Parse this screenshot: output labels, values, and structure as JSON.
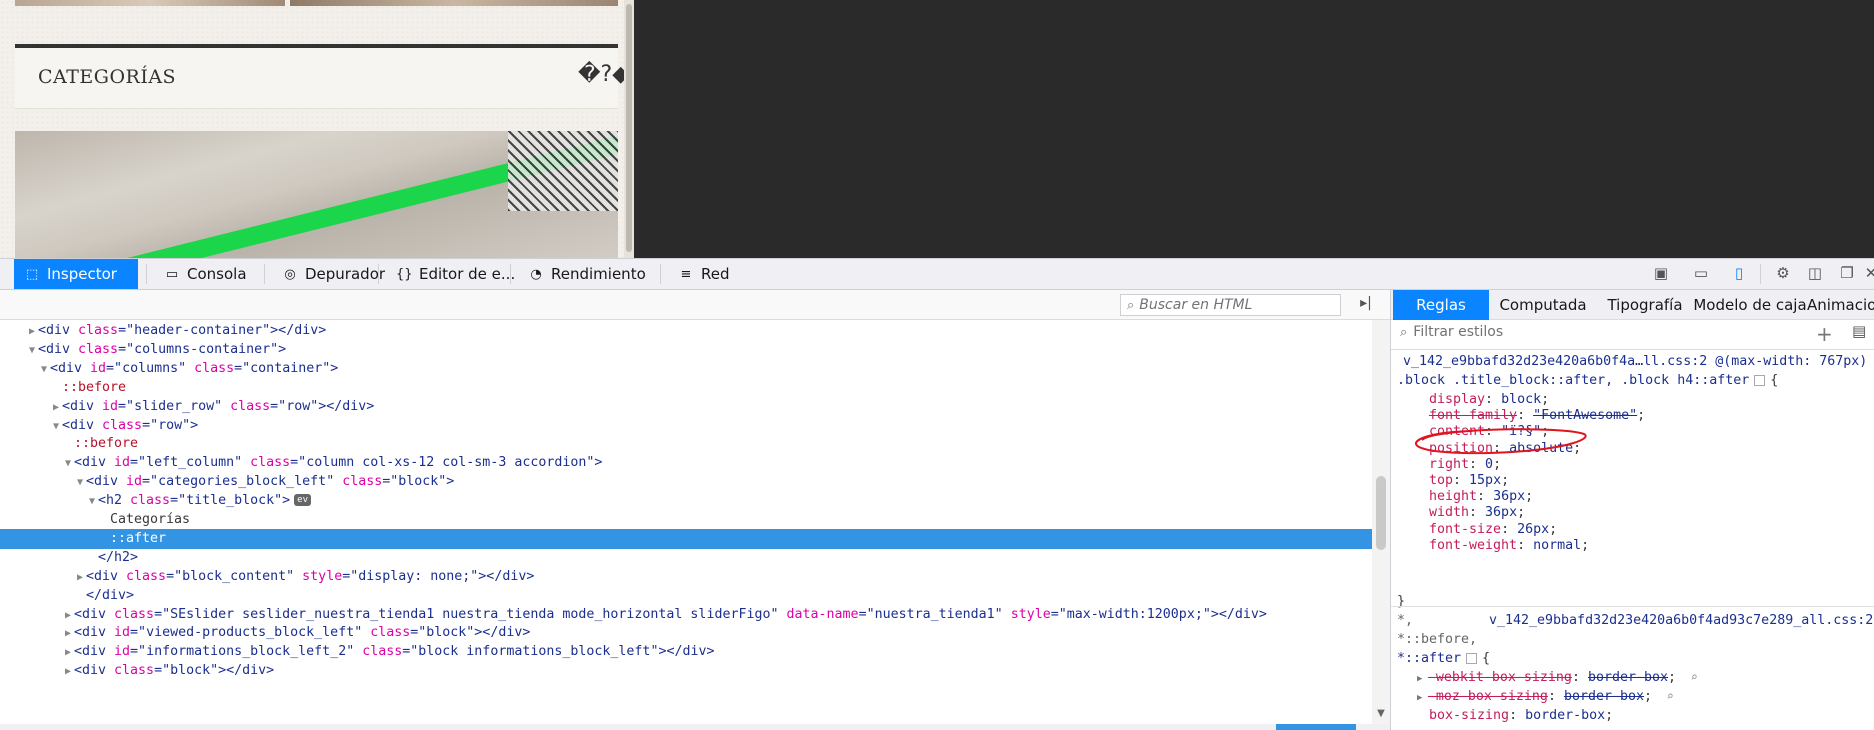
{
  "page": {
    "block_title": "CATEGORÍAS",
    "bad_glyph": "�?◆"
  },
  "toolbar": {
    "tabs": [
      {
        "label": "Inspector",
        "icon": "inspector-icon"
      },
      {
        "label": "Consola",
        "icon": "console-icon"
      },
      {
        "label": "Depurador",
        "icon": "debugger-icon"
      },
      {
        "label": "Editor de e...",
        "icon": "style-editor-icon"
      },
      {
        "label": "Rendimiento",
        "icon": "performance-icon"
      },
      {
        "label": "Red",
        "icon": "network-icon"
      }
    ],
    "accent": "#0a84ff"
  },
  "html_panel": {
    "search_placeholder": "Buscar en HTML"
  },
  "markup": [
    {
      "t": "tw:right",
      "parts": [
        [
          "tg",
          "<div "
        ],
        [
          "an",
          "class"
        ],
        [
          "tg",
          "=\""
        ],
        [
          "av",
          "header-container"
        ],
        [
          "tg",
          "\"></div>"
        ]
      ]
    },
    {
      "t": "tw:down",
      "parts": [
        [
          "tg",
          "<div "
        ],
        [
          "an",
          "class"
        ],
        [
          "tg",
          "=\""
        ],
        [
          "av",
          "columns-container"
        ],
        [
          "tg",
          "\">"
        ]
      ]
    },
    {
      "t": "tw:down",
      "parts": [
        [
          "tg",
          "<div "
        ],
        [
          "an",
          "id"
        ],
        [
          "tg",
          "=\""
        ],
        [
          "av",
          "columns"
        ],
        [
          "tg",
          "\" "
        ],
        [
          "an",
          "class"
        ],
        [
          "tg",
          "=\""
        ],
        [
          "av",
          "container"
        ],
        [
          "tg",
          "\">"
        ]
      ]
    },
    {
      "t": "none",
      "parts": [
        [
          "pe",
          "::before"
        ]
      ]
    },
    {
      "t": "tw:right",
      "parts": [
        [
          "tg",
          "<div "
        ],
        [
          "an",
          "id"
        ],
        [
          "tg",
          "=\""
        ],
        [
          "av",
          "slider_row"
        ],
        [
          "tg",
          "\" "
        ],
        [
          "an",
          "class"
        ],
        [
          "tg",
          "=\""
        ],
        [
          "av",
          "row"
        ],
        [
          "tg",
          "\"></div>"
        ]
      ]
    },
    {
      "t": "tw:down",
      "parts": [
        [
          "tg",
          "<div "
        ],
        [
          "an",
          "class"
        ],
        [
          "tg",
          "=\""
        ],
        [
          "av",
          "row"
        ],
        [
          "tg",
          "\">"
        ]
      ]
    },
    {
      "t": "none",
      "parts": [
        [
          "pe",
          "::before"
        ]
      ]
    },
    {
      "t": "tw:down",
      "parts": [
        [
          "tg",
          "<div "
        ],
        [
          "an",
          "id"
        ],
        [
          "tg",
          "=\""
        ],
        [
          "av",
          "left_column"
        ],
        [
          "tg",
          "\" "
        ],
        [
          "an",
          "class"
        ],
        [
          "tg",
          "=\""
        ],
        [
          "av",
          "column col-xs-12 col-sm-3 accordion"
        ],
        [
          "tg",
          "\">"
        ]
      ]
    },
    {
      "t": "tw:down",
      "parts": [
        [
          "tg",
          "<div "
        ],
        [
          "an",
          "id"
        ],
        [
          "tg",
          "=\""
        ],
        [
          "av",
          "categories_block_left"
        ],
        [
          "tg",
          "\" "
        ],
        [
          "an",
          "class"
        ],
        [
          "tg",
          "=\""
        ],
        [
          "av",
          "block"
        ],
        [
          "tg",
          "\">"
        ]
      ]
    },
    {
      "t": "tw:down",
      "parts": [
        [
          "tg",
          "<h2 "
        ],
        [
          "an",
          "class"
        ],
        [
          "tg",
          "=\""
        ],
        [
          "av",
          "title_block"
        ],
        [
          "tg",
          "\">"
        ]
      ],
      "badge": "ev"
    },
    {
      "t": "none",
      "parts": [
        [
          "txt",
          "Categorías"
        ]
      ]
    },
    {
      "t": "none",
      "parts": [
        [
          "sel",
          "::after"
        ]
      ]
    },
    {
      "t": "none",
      "parts": [
        [
          "tg",
          "</h2>"
        ]
      ]
    },
    {
      "t": "tw:right",
      "parts": [
        [
          "tg",
          "<div "
        ],
        [
          "an",
          "class"
        ],
        [
          "tg",
          "=\""
        ],
        [
          "av",
          "block_content"
        ],
        [
          "tg",
          "\" "
        ],
        [
          "an",
          "style"
        ],
        [
          "tg",
          "=\""
        ],
        [
          "av",
          "display: none;"
        ],
        [
          "tg",
          "\"></div>"
        ]
      ]
    },
    {
      "t": "none",
      "parts": [
        [
          "tg",
          "</div>"
        ]
      ]
    },
    {
      "t": "tw:right",
      "parts": [
        [
          "tg",
          "<div "
        ],
        [
          "an",
          "class"
        ],
        [
          "tg",
          "=\""
        ],
        [
          "av",
          "SEslider seslider_nuestra_tienda1 nuestra_tienda mode_horizontal sliderFigo"
        ],
        [
          "tg",
          "\" "
        ],
        [
          "an",
          "data-name"
        ],
        [
          "tg",
          "=\""
        ],
        [
          "av",
          "nuestra_tienda1"
        ],
        [
          "tg",
          "\" "
        ],
        [
          "an",
          "style"
        ],
        [
          "tg",
          "=\""
        ],
        [
          "av",
          "max-width:1200px;"
        ],
        [
          "tg",
          "\"></div>"
        ]
      ]
    },
    {
      "t": "tw:right",
      "parts": [
        [
          "tg",
          "<div "
        ],
        [
          "an",
          "id"
        ],
        [
          "tg",
          "=\""
        ],
        [
          "av",
          "viewed-products_block_left"
        ],
        [
          "tg",
          "\" "
        ],
        [
          "an",
          "class"
        ],
        [
          "tg",
          "=\""
        ],
        [
          "av",
          "block"
        ],
        [
          "tg",
          "\"></div>"
        ]
      ]
    },
    {
      "t": "tw:right",
      "parts": [
        [
          "tg",
          "<div "
        ],
        [
          "an",
          "id"
        ],
        [
          "tg",
          "=\""
        ],
        [
          "av",
          "informations_block_left_2"
        ],
        [
          "tg",
          "\" "
        ],
        [
          "an",
          "class"
        ],
        [
          "tg",
          "=\""
        ],
        [
          "av",
          "block informations_block_left"
        ],
        [
          "tg",
          "\"></div>"
        ]
      ]
    },
    {
      "t": "tw:right",
      "parts": [
        [
          "tg",
          "<div "
        ],
        [
          "an",
          "class"
        ],
        [
          "tg",
          "=\""
        ],
        [
          "av",
          "block"
        ],
        [
          "tg",
          "\"></div>"
        ]
      ]
    }
  ],
  "rules_panel": {
    "tabs": [
      "Reglas",
      "Computada",
      "Tipografía",
      "Modelo de caja",
      "Animacion"
    ],
    "filter_placeholder": "Filtrar estilos",
    "rule1": {
      "source": "v_142_e9bbafd32d23e420a6b0f4a…ll.css:2 @(max-width: 767px)",
      "selector": ".block .title_block::after, .block h4::after",
      "props": [
        {
          "n": "display",
          "v": "block"
        },
        {
          "n": "font-family",
          "v": "\"FontAwesome\""
        },
        {
          "n": "content",
          "v": "\"ï?§\""
        },
        {
          "n": "position",
          "v": "absolute"
        },
        {
          "n": "right",
          "v": "0"
        },
        {
          "n": "top",
          "v": "15px"
        },
        {
          "n": "height",
          "v": "36px"
        },
        {
          "n": "width",
          "v": "36px"
        },
        {
          "n": "font-size",
          "v": "26px"
        },
        {
          "n": "font-weight",
          "v": "normal"
        }
      ]
    },
    "rule2": {
      "source": "v_142_e9bbafd32d23e420a6b0f4ad93c7e289_all.css:2",
      "selector_lines": [
        "*,",
        "*::before,",
        "*::after"
      ],
      "props": [
        {
          "n": "-webkit-box-sizing",
          "v": "border-box",
          "struck": true
        },
        {
          "n": "-moz-box-sizing",
          "v": "border-box",
          "struck": true
        },
        {
          "n": "box-sizing",
          "v": "border-box",
          "struck": false
        }
      ]
    }
  }
}
